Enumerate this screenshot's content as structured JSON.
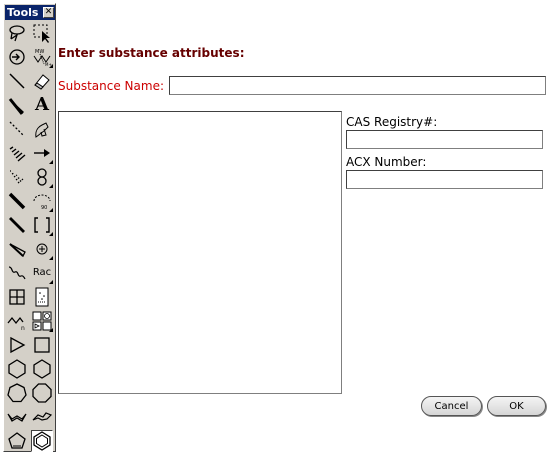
{
  "palette": {
    "title": "Tools",
    "close_glyph": "✕",
    "text_tool_glyph": "A",
    "rac_label": "Rac",
    "tools": [
      "lasso-select-icon",
      "marquee-select-icon",
      "rotate-icon",
      "mass-fragment-icon",
      "bond-single-icon",
      "eraser-icon",
      "bond-wedge-hollow-icon",
      "text-icon",
      "bond-dashed-icon",
      "pen-icon",
      "bond-hashed-icon",
      "arrow-icon",
      "bond-hashed-wedge-icon",
      "orbital-icon",
      "bond-bold-icon",
      "arc-icon",
      "bond-wedge-icon",
      "bracket-icon",
      "bond-hollow-wedge-icon",
      "charge-icon",
      "bond-wavy-icon",
      "rac-label-icon",
      "table-icon",
      "tlc-plate-icon",
      "chain-icon",
      "template-icon",
      "triangle-icon",
      "square-icon",
      "pentagon-ring-icon",
      "hexagon-ring-icon",
      "heptagon-ring-icon",
      "octagon-ring-icon",
      "cyclohexane-chair1-icon",
      "cyclohexane-chair2-icon",
      "cyclopentadiene-icon",
      "benzene-icon"
    ]
  },
  "form": {
    "heading": "Enter substance attributes:",
    "name_label": "Substance Name:",
    "name_value": "",
    "cas_label": "CAS Registry#:",
    "cas_value": "",
    "acx_label": "ACX Number:",
    "acx_value": ""
  },
  "buttons": {
    "cancel": "Cancel",
    "ok": "OK"
  }
}
